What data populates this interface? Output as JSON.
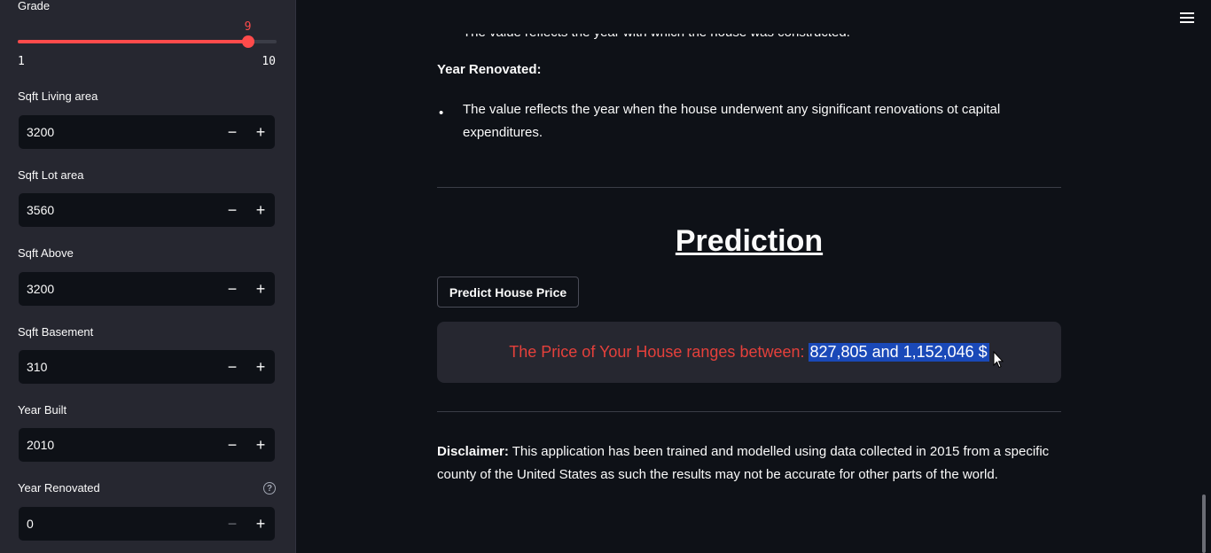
{
  "sidebar": {
    "grade": {
      "label": "Grade",
      "value": "9",
      "min": "1",
      "max": "10",
      "fraction": 0.889
    },
    "inputs": [
      {
        "label": "Sqft Living area",
        "value": "3200"
      },
      {
        "label": "Sqft Lot area",
        "value": "3560"
      },
      {
        "label": "Sqft Above",
        "value": "3200"
      },
      {
        "label": "Sqft Basement",
        "value": "310"
      },
      {
        "label": "Year Built",
        "value": "2010"
      },
      {
        "label": "Year Renovated",
        "value": "0"
      }
    ],
    "minus": "−",
    "plus": "+",
    "help": "?"
  },
  "main": {
    "cut_text": "The value reflects the year with which the house was constructed.",
    "year_renovated_heading": "Year Renovated:",
    "bullet": "•",
    "year_renovated_text": "The value reflects the year when the house underwent any significant renovations ot capital expenditures.",
    "prediction_heading": "Prediction",
    "predict_button": "Predict House Price",
    "result_prefix": "The Price of Your House ranges between:",
    "result_value": "827,805 and 1,152,046 $",
    "disclaimer_label": "Disclaimer:",
    "disclaimer_text": " This application has been trained and modelled using data collected in 2015 from a specific county of the United States as such the results may not be accurate for other parts of the world."
  },
  "colors": {
    "accent": "#ff4b4b",
    "background": "#0e1117",
    "sidebar": "#262730",
    "selection": "#1a49b8"
  }
}
